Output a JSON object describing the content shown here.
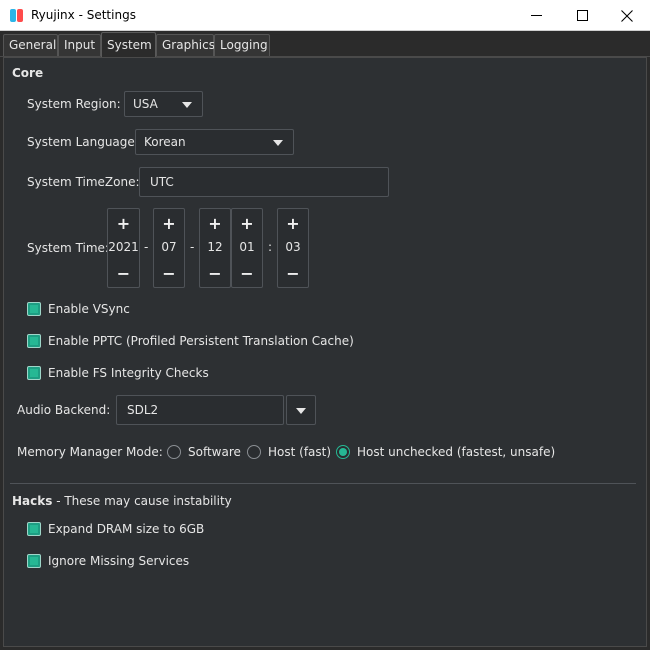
{
  "window": {
    "title": "Ryujinx - Settings",
    "controls": [
      "minimize-icon",
      "maximize-icon",
      "close-icon"
    ]
  },
  "tabs": [
    {
      "label": "General",
      "active": false
    },
    {
      "label": "Input",
      "active": false
    },
    {
      "label": "System",
      "active": true
    },
    {
      "label": "Graphics",
      "active": false
    },
    {
      "label": "Logging",
      "active": false
    }
  ],
  "core": {
    "section_title": "Core",
    "region": {
      "label": "System Region:",
      "value": "USA"
    },
    "language": {
      "label": "System Language:",
      "value": "Korean"
    },
    "timezone": {
      "label": "System TimeZone:",
      "value": "UTC"
    },
    "time": {
      "label": "System Time:",
      "year": "2021",
      "month": "07",
      "day": "12",
      "hour": "01",
      "minute": "03",
      "date_sep": "-",
      "time_sep": ":",
      "plus": "+",
      "minus": "−"
    },
    "vsync": {
      "label": "Enable VSync",
      "checked": true
    },
    "pptc": {
      "label": "Enable PPTC (Profiled Persistent Translation Cache)",
      "checked": true
    },
    "fs_integrity": {
      "label": "Enable FS Integrity Checks",
      "checked": true
    },
    "audio": {
      "label": "Audio Backend:",
      "value": "SDL2"
    },
    "memory": {
      "label": "Memory Manager Mode:",
      "options": [
        {
          "label": "Software",
          "selected": false
        },
        {
          "label": "Host (fast)",
          "selected": false
        },
        {
          "label": "Host unchecked (fastest, unsafe)",
          "selected": true
        }
      ]
    }
  },
  "hacks": {
    "section_title": "Hacks",
    "section_note": " - These may cause instability",
    "expand_dram": {
      "label": "Expand DRAM size to 6GB",
      "checked": true
    },
    "ignore_services": {
      "label": "Ignore Missing Services",
      "checked": true
    }
  },
  "colors": {
    "accent": "#26b894",
    "background": "#2d3033",
    "text": "#e6e6e6"
  }
}
